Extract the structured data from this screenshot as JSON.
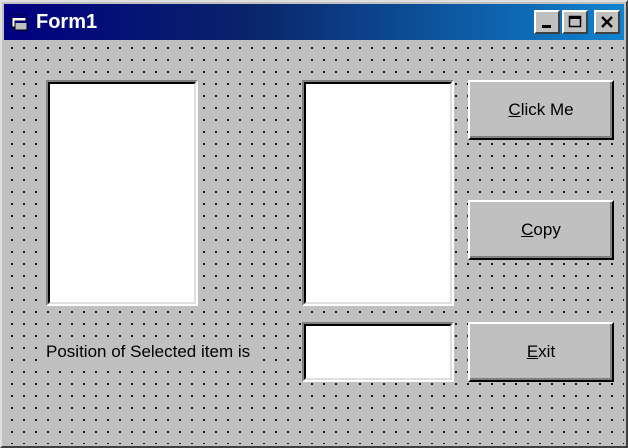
{
  "window": {
    "title": "Form1",
    "controls": {
      "minimize_icon": "minimize-icon",
      "maximize_icon": "maximize-icon",
      "close_icon": "close-icon"
    }
  },
  "form": {
    "position_label": "Position of Selected item is",
    "buttons": {
      "click_me": {
        "accel": "C",
        "rest": "lick Me"
      },
      "copy": {
        "accel": "C",
        "rest": "opy"
      },
      "exit": {
        "accel": "E",
        "rest": "xit"
      }
    },
    "position_value": ""
  },
  "colors": {
    "face": "#c0c0c0",
    "title_start": "#000080",
    "title_end": "#1084d0",
    "field_bg": "#ffffff"
  }
}
